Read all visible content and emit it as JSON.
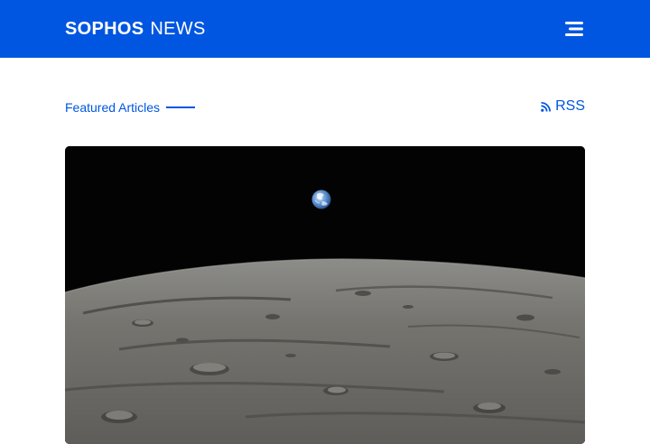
{
  "header": {
    "brand": "SOPHOS",
    "product": "NEWS",
    "menu_icon": "hamburger-menu-icon",
    "background_color": "#0056e0"
  },
  "featured": {
    "label": "Featured Articles",
    "rss_label": "RSS",
    "rss_icon": "rss-icon"
  },
  "hero": {
    "image_alt": "Earth rising over the lunar horizon",
    "accent_color": "#0056e0"
  }
}
